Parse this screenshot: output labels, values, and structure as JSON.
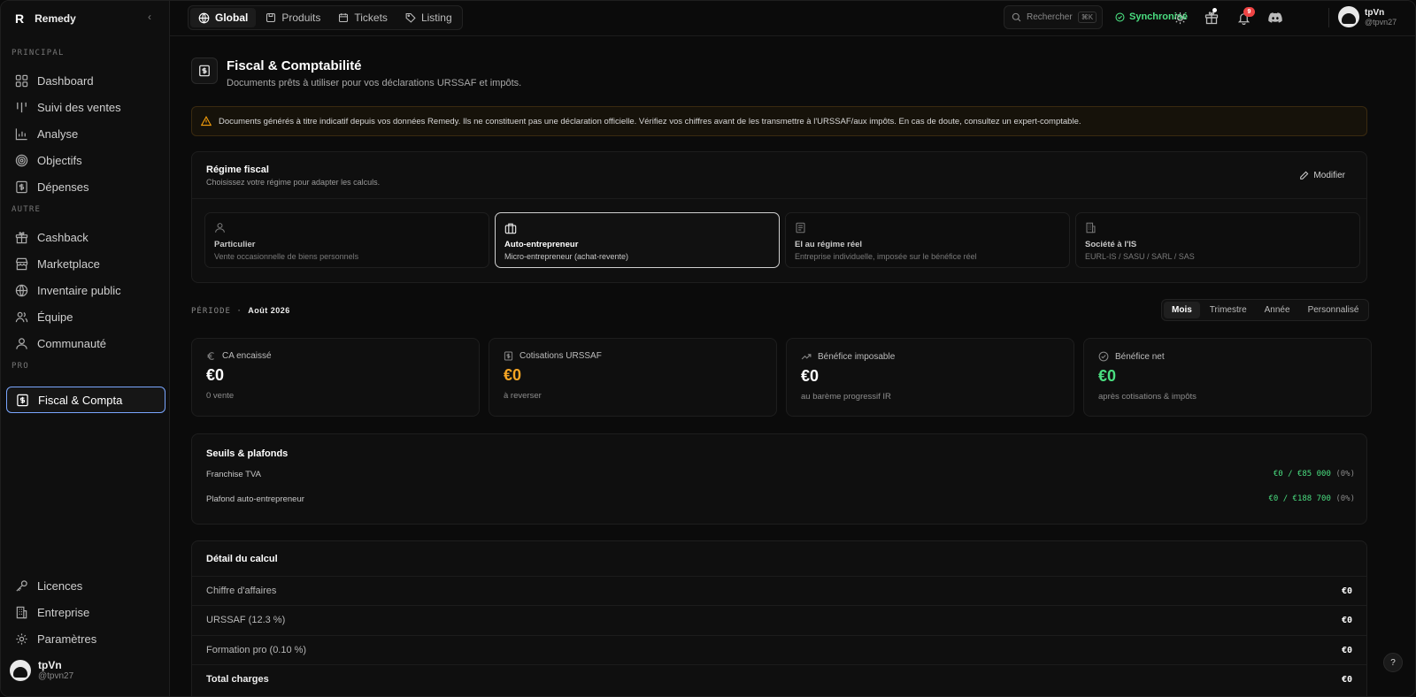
{
  "brand": {
    "logo": "R",
    "name": "Remedy"
  },
  "sidebar": {
    "sections": {
      "principal": "PRINCIPAL",
      "autre": "AUTRE",
      "pro": "PRO"
    },
    "items": [
      {
        "label": "Dashboard",
        "icon": "grid-icon"
      },
      {
        "label": "Suivi des ventes",
        "icon": "bars-icon"
      },
      {
        "label": "Analyse",
        "icon": "chart-icon"
      },
      {
        "label": "Objectifs",
        "icon": "target-icon"
      },
      {
        "label": "Dépenses",
        "icon": "receipt-icon"
      },
      {
        "label": "Cashback",
        "icon": "gift-icon"
      },
      {
        "label": "Marketplace",
        "icon": "store-icon"
      },
      {
        "label": "Inventaire public",
        "icon": "globe-icon"
      },
      {
        "label": "Équipe",
        "icon": "users-icon"
      },
      {
        "label": "Communauté",
        "icon": "user-icon"
      },
      {
        "label": "Fiscal & Compta",
        "icon": "dollar-doc-icon"
      },
      {
        "label": "Licences",
        "icon": "key-icon"
      },
      {
        "label": "Entreprise",
        "icon": "building-icon"
      },
      {
        "label": "Paramètres",
        "icon": "gear-icon"
      }
    ],
    "user": {
      "name": "tpVn",
      "handle": "@tpvn27"
    }
  },
  "topbar": {
    "tabs": [
      {
        "label": "Global",
        "icon": "globe-icon"
      },
      {
        "label": "Produits",
        "icon": "box-icon"
      },
      {
        "label": "Tickets",
        "icon": "calendar-icon"
      },
      {
        "label": "Listing",
        "icon": "tag-icon"
      }
    ],
    "search": {
      "placeholder": "Rechercher",
      "shortcut": "⌘K"
    },
    "sync": "Synchronisé",
    "notifications": "9",
    "user": {
      "name": "tpVn",
      "handle": "@tpvn27"
    }
  },
  "page": {
    "title": "Fiscal & Comptabilité",
    "subtitle": "Documents prêts à utiliser pour vos déclarations URSSAF et impôts.",
    "warning": "Documents générés à titre indicatif depuis vos données Remedy. Ils ne constituent pas une déclaration officielle. Vérifiez vos chiffres avant de les transmettre à l'URSSAF/aux impôts. En cas de doute, consultez un expert-comptable."
  },
  "regime": {
    "title": "Régime fiscal",
    "subtitle": "Choisissez votre régime pour adapter les calculs.",
    "modify": "Modifier",
    "options": [
      {
        "title": "Particulier",
        "sub": "Vente occasionnelle de biens personnels",
        "icon": "user-icon"
      },
      {
        "title": "Auto-entrepreneur",
        "sub": "Micro-entrepreneur (achat-revente)",
        "icon": "briefcase-icon",
        "selected": true
      },
      {
        "title": "EI au régime réel",
        "sub": "Entreprise individuelle, imposée sur le bénéfice réel",
        "icon": "document-icon"
      },
      {
        "title": "Société à l'IS",
        "sub": "EURL-IS / SASU / SARL / SAS",
        "icon": "building-icon"
      }
    ]
  },
  "period": {
    "label": "PÉRIODE ·",
    "value": "Août 2026",
    "options": [
      "Mois",
      "Trimestre",
      "Année",
      "Personnalisé"
    ],
    "selected": "Mois"
  },
  "stats": [
    {
      "label": "CA encaissé",
      "value": "€0",
      "sub": "0 vente",
      "icon": "euro-icon",
      "color": "#ffffff"
    },
    {
      "label": "Cotisations URSSAF",
      "value": "€0",
      "sub": "à reverser",
      "icon": "receipt-icon",
      "color": "#f5a524"
    },
    {
      "label": "Bénéfice imposable",
      "value": "€0",
      "sub": "au barème progressif IR",
      "icon": "trend-icon",
      "color": "#ffffff"
    },
    {
      "label": "Bénéfice net",
      "value": "€0",
      "sub": "après cotisations & impôts",
      "icon": "check-circle-icon",
      "color": "#4ade80"
    }
  ],
  "seuils": {
    "title": "Seuils & plafonds",
    "rows": [
      {
        "label": "Franchise TVA",
        "value": "€0 / €85 000",
        "pct": "(0%)"
      },
      {
        "label": "Plafond auto-entrepreneur",
        "value": "€0 / €188 700",
        "pct": "(0%)"
      }
    ]
  },
  "detail": {
    "title": "Détail du calcul",
    "rows": [
      {
        "label": "Chiffre d'affaires",
        "value": "€0"
      },
      {
        "label": "URSSAF (12.3 %)",
        "value": "€0"
      },
      {
        "label": "Formation pro (0.10 %)",
        "value": "€0"
      },
      {
        "label": "Total charges",
        "value": "€0"
      }
    ]
  },
  "help": "?"
}
